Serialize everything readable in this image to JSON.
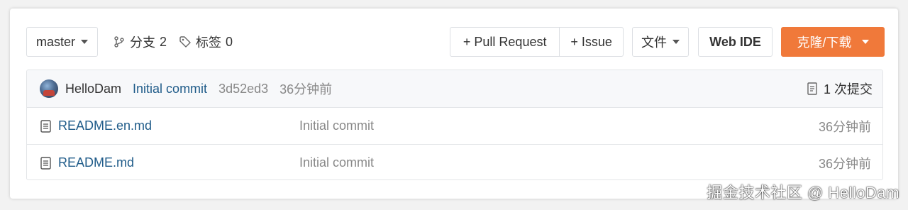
{
  "toolbar": {
    "branch_select": {
      "value": "master"
    },
    "branches": {
      "label": "分支",
      "count": "2"
    },
    "tags": {
      "label": "标签",
      "count": "0"
    },
    "pull_request_label": "+ Pull Request",
    "issue_label": "+ Issue",
    "file_menu_label": "文件",
    "web_ide_label": "Web IDE",
    "clone_label": "克隆/下载"
  },
  "latest_commit": {
    "author": "HelloDam",
    "message": "Initial commit",
    "sha": "3d52ed3",
    "time": "36分钟前",
    "commit_count": "1 次提交"
  },
  "files": [
    {
      "name": "README.en.md",
      "message": "Initial commit",
      "time": "36分钟前"
    },
    {
      "name": "README.md",
      "message": "Initial commit",
      "time": "36分钟前"
    }
  ],
  "watermark": "掘金技术社区 @ HelloDam",
  "colors": {
    "accent": "#f0793a",
    "link": "#1f5b89"
  }
}
